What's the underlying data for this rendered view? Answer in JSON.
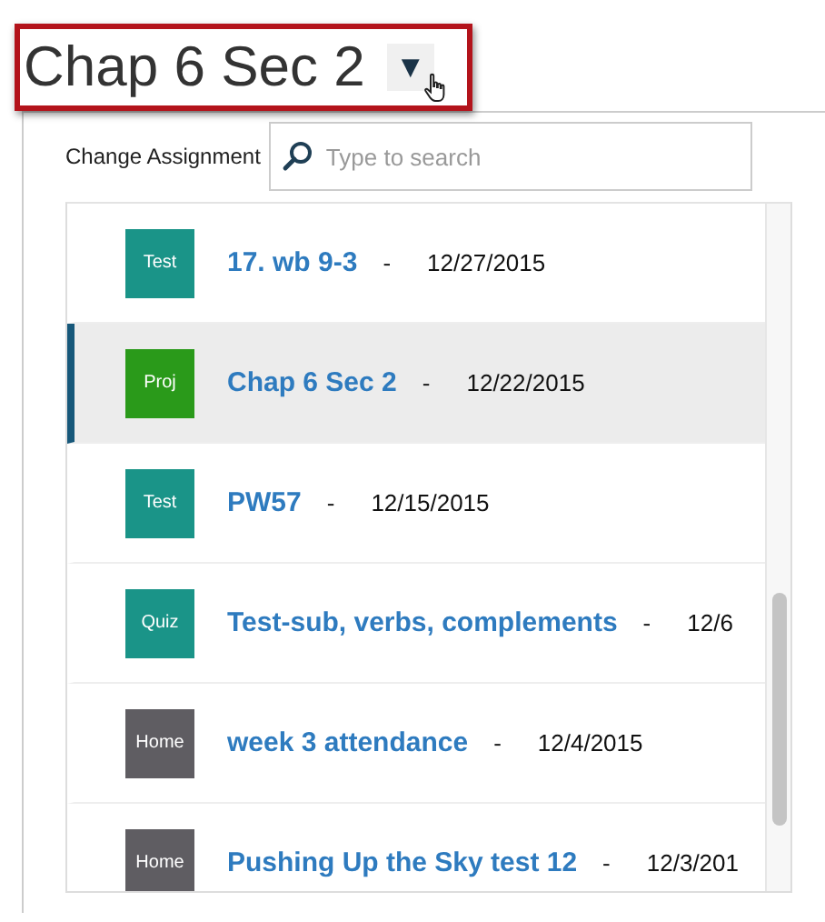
{
  "header": {
    "title": "Chap 6 Sec 2",
    "dropdown_icon": "▼"
  },
  "panel": {
    "label": "Change Assignment",
    "search": {
      "placeholder": "Type to search"
    }
  },
  "assignments": [
    {
      "badge": "Test",
      "color": "#1a9488",
      "title": "17. wb 9-3",
      "separator": "-",
      "date": "12/27/2015",
      "selected": false
    },
    {
      "badge": "Proj",
      "color": "#2a9a1a",
      "title": "Chap 6 Sec 2",
      "separator": "-",
      "date": "12/22/2015",
      "selected": true
    },
    {
      "badge": "Test",
      "color": "#1a9488",
      "title": "PW57",
      "separator": "-",
      "date": "12/15/2015",
      "selected": false
    },
    {
      "badge": "Quiz",
      "color": "#1a9488",
      "title": "Test-sub, verbs, complements",
      "separator": "-",
      "date": "12/6",
      "selected": false
    },
    {
      "badge": "Home",
      "color": "#5f5d62",
      "title": "week 3 attendance",
      "separator": "-",
      "date": "12/4/2015",
      "selected": false
    },
    {
      "badge": "Home",
      "color": "#5f5d62",
      "title": "Pushing Up the Sky test 12",
      "separator": "-",
      "date": "12/3/201",
      "selected": false
    }
  ]
}
